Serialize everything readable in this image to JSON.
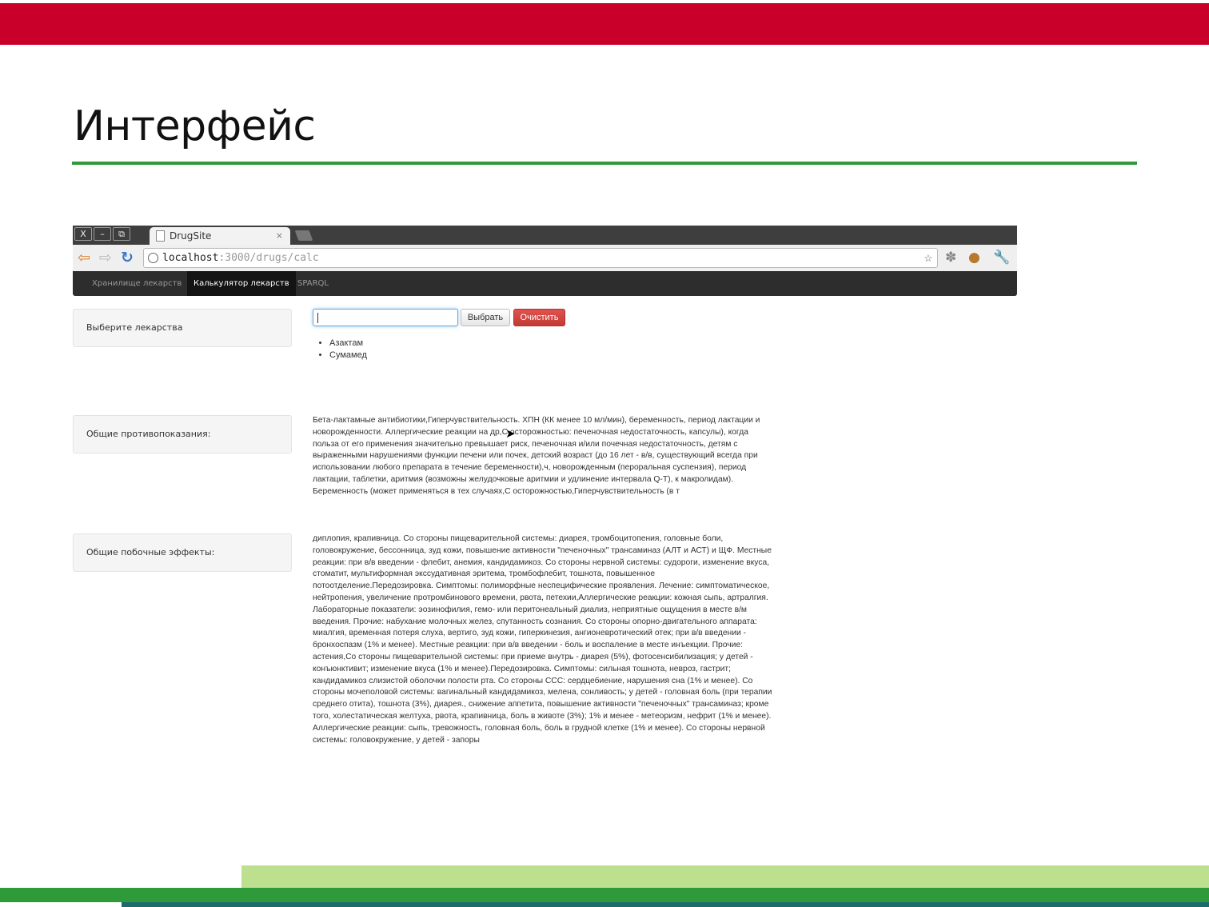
{
  "slide": {
    "title": "Интерфейс"
  },
  "browser": {
    "window_buttons": [
      "X",
      "–",
      "⧉"
    ],
    "tab_title": "DrugSite",
    "tab_close": "×",
    "url_host": "localhost",
    "url_rest": ":3000/drugs/calc",
    "icons": [
      "back-icon",
      "forward-icon",
      "reload-icon",
      "globe-icon",
      "star-icon",
      "paw-icon",
      "cookie-icon",
      "wrench-icon"
    ]
  },
  "app": {
    "nav": {
      "items": [
        "Хранилище лекарств",
        "Калькулятор лекарств",
        "SPARQL"
      ],
      "active_index": 1
    },
    "select_label": "Выберите лекарства",
    "input_value": "",
    "choose_button": "Выбрать",
    "clear_button": "Очистить",
    "selected_drugs": [
      "Азактам",
      "Сумамед"
    ],
    "contraindications_label": "Общие противопоказания:",
    "contraindications_text": "Бета-лактамные антибиотики,Гиперчувствительность. ХПН (КК менее 10 мл/мин), беременность, период лактации и новорожденности. Аллергические реакции на др,С осторожностью: печеночная недостаточность, капсулы), когда польза от его применения значительно превышает риск, печеночная и/или почечная недостаточность, детям с выраженными нарушениями функции печени или почек, детский возраст (до 16 лет - в/в, существующий всегда при использовании любого препарата в течение беременности),ч, новорожденным (пероральная суспензия), период лактации, таблетки, аритмия (возможны желудочковые аритмии и удлинение интервала Q-T), к макролидам). Беременность (может применяться в тех случаях,С осторожностью,Гиперчувствительность (в т",
    "side_effects_label": "Общие побочные эффекты:",
    "side_effects_text": "диплопия, крапивница. Со стороны пищеварительной системы: диарея, тромбоцитопения, головные боли, головокружение, бессонница, зуд кожи, повышение активности \"печеночных\" трансаминаз (АЛТ и АСТ) и ЩФ. Местные реакции: при в/в введении - флебит, анемия, кандидамикоз. Со стороны нервной системы: судороги, изменение вкуса, стоматит, мультиформная экссудативная эритема, тромбофлебит, тошнота, повышенное потоотделение.Передозировка. Симптомы: полиморфные неспецифические проявления. Лечение: симптоматическое, нейтропения, увеличение протромбинового времени, рвота, петехии,Аллергические реакции: кожная сыпь, артралгия. Лабораторные показатели: эозинофилия, гемо- или перитонеальный диализ, неприятные ощущения в месте в/м введения. Прочие: набухание молочных желез, спутанность сознания. Со стороны опорно-двигательного аппарата: миалгия, временная потеря слуха, вертиго, зуд кожи, гиперкинезия, ангионевротический отек; при в/в введении - бронхоспазм (1% и менее). Местные реакции: при в/в введении - боль и воспаление в месте инъекции. Прочие: астения,Со стороны пищеварительной системы: при приеме внутрь - диарея (5%), фотосенсибилизация; у детей - конъюнктивит; изменение вкуса (1% и менее).Передозировка. Симптомы: сильная тошнота, невроз, гастрит; кандидамикоз слизистой оболочки полости рта. Со стороны ССС: сердцебиение, нарушения сна (1% и менее). Со стороны мочеполовой системы: вагинальный кандидамикоз, мелена, сонливость; у детей - головная боль (при терапии среднего отита), тошнота (3%), диарея., снижение аппетита, повышение активности \"печеночных\" трансаминаз; кроме того, холестатическая желтуха, рвота, крапивница, боль в животе (3%); 1% и менее - метеоризм, нефрит (1% и менее). Аллергические реакции: сыпь, тревожность, головная боль, боль в грудной клетке (1% и менее). Со стороны нервной системы: головокружение, у детей - запоры"
  },
  "colors": {
    "header_red": "#c8002a",
    "rule_green": "#2e9a3a",
    "footer_light_green": "#bde08f",
    "footer_teal": "#1e6b6e",
    "clear_button_red": "#d9534f"
  }
}
